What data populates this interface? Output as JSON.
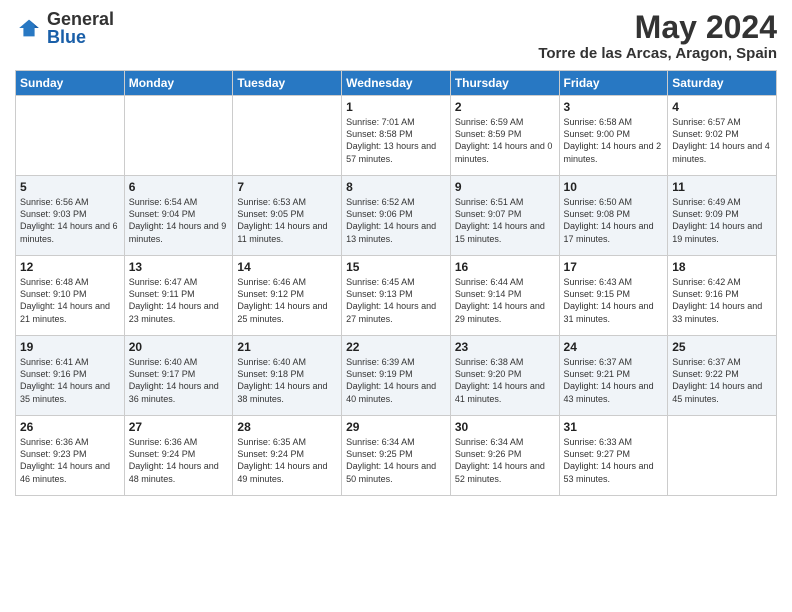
{
  "logo": {
    "general": "General",
    "blue": "Blue"
  },
  "title": "May 2024",
  "location": "Torre de las Arcas, Aragon, Spain",
  "headers": [
    "Sunday",
    "Monday",
    "Tuesday",
    "Wednesday",
    "Thursday",
    "Friday",
    "Saturday"
  ],
  "weeks": [
    [
      {
        "day": "",
        "info": ""
      },
      {
        "day": "",
        "info": ""
      },
      {
        "day": "",
        "info": ""
      },
      {
        "day": "1",
        "info": "Sunrise: 7:01 AM\nSunset: 8:58 PM\nDaylight: 13 hours and 57 minutes."
      },
      {
        "day": "2",
        "info": "Sunrise: 6:59 AM\nSunset: 8:59 PM\nDaylight: 14 hours and 0 minutes."
      },
      {
        "day": "3",
        "info": "Sunrise: 6:58 AM\nSunset: 9:00 PM\nDaylight: 14 hours and 2 minutes."
      },
      {
        "day": "4",
        "info": "Sunrise: 6:57 AM\nSunset: 9:02 PM\nDaylight: 14 hours and 4 minutes."
      }
    ],
    [
      {
        "day": "5",
        "info": "Sunrise: 6:56 AM\nSunset: 9:03 PM\nDaylight: 14 hours and 6 minutes."
      },
      {
        "day": "6",
        "info": "Sunrise: 6:54 AM\nSunset: 9:04 PM\nDaylight: 14 hours and 9 minutes."
      },
      {
        "day": "7",
        "info": "Sunrise: 6:53 AM\nSunset: 9:05 PM\nDaylight: 14 hours and 11 minutes."
      },
      {
        "day": "8",
        "info": "Sunrise: 6:52 AM\nSunset: 9:06 PM\nDaylight: 14 hours and 13 minutes."
      },
      {
        "day": "9",
        "info": "Sunrise: 6:51 AM\nSunset: 9:07 PM\nDaylight: 14 hours and 15 minutes."
      },
      {
        "day": "10",
        "info": "Sunrise: 6:50 AM\nSunset: 9:08 PM\nDaylight: 14 hours and 17 minutes."
      },
      {
        "day": "11",
        "info": "Sunrise: 6:49 AM\nSunset: 9:09 PM\nDaylight: 14 hours and 19 minutes."
      }
    ],
    [
      {
        "day": "12",
        "info": "Sunrise: 6:48 AM\nSunset: 9:10 PM\nDaylight: 14 hours and 21 minutes."
      },
      {
        "day": "13",
        "info": "Sunrise: 6:47 AM\nSunset: 9:11 PM\nDaylight: 14 hours and 23 minutes."
      },
      {
        "day": "14",
        "info": "Sunrise: 6:46 AM\nSunset: 9:12 PM\nDaylight: 14 hours and 25 minutes."
      },
      {
        "day": "15",
        "info": "Sunrise: 6:45 AM\nSunset: 9:13 PM\nDaylight: 14 hours and 27 minutes."
      },
      {
        "day": "16",
        "info": "Sunrise: 6:44 AM\nSunset: 9:14 PM\nDaylight: 14 hours and 29 minutes."
      },
      {
        "day": "17",
        "info": "Sunrise: 6:43 AM\nSunset: 9:15 PM\nDaylight: 14 hours and 31 minutes."
      },
      {
        "day": "18",
        "info": "Sunrise: 6:42 AM\nSunset: 9:16 PM\nDaylight: 14 hours and 33 minutes."
      }
    ],
    [
      {
        "day": "19",
        "info": "Sunrise: 6:41 AM\nSunset: 9:16 PM\nDaylight: 14 hours and 35 minutes."
      },
      {
        "day": "20",
        "info": "Sunrise: 6:40 AM\nSunset: 9:17 PM\nDaylight: 14 hours and 36 minutes."
      },
      {
        "day": "21",
        "info": "Sunrise: 6:40 AM\nSunset: 9:18 PM\nDaylight: 14 hours and 38 minutes."
      },
      {
        "day": "22",
        "info": "Sunrise: 6:39 AM\nSunset: 9:19 PM\nDaylight: 14 hours and 40 minutes."
      },
      {
        "day": "23",
        "info": "Sunrise: 6:38 AM\nSunset: 9:20 PM\nDaylight: 14 hours and 41 minutes."
      },
      {
        "day": "24",
        "info": "Sunrise: 6:37 AM\nSunset: 9:21 PM\nDaylight: 14 hours and 43 minutes."
      },
      {
        "day": "25",
        "info": "Sunrise: 6:37 AM\nSunset: 9:22 PM\nDaylight: 14 hours and 45 minutes."
      }
    ],
    [
      {
        "day": "26",
        "info": "Sunrise: 6:36 AM\nSunset: 9:23 PM\nDaylight: 14 hours and 46 minutes."
      },
      {
        "day": "27",
        "info": "Sunrise: 6:36 AM\nSunset: 9:24 PM\nDaylight: 14 hours and 48 minutes."
      },
      {
        "day": "28",
        "info": "Sunrise: 6:35 AM\nSunset: 9:24 PM\nDaylight: 14 hours and 49 minutes."
      },
      {
        "day": "29",
        "info": "Sunrise: 6:34 AM\nSunset: 9:25 PM\nDaylight: 14 hours and 50 minutes."
      },
      {
        "day": "30",
        "info": "Sunrise: 6:34 AM\nSunset: 9:26 PM\nDaylight: 14 hours and 52 minutes."
      },
      {
        "day": "31",
        "info": "Sunrise: 6:33 AM\nSunset: 9:27 PM\nDaylight: 14 hours and 53 minutes."
      },
      {
        "day": "",
        "info": ""
      }
    ]
  ]
}
